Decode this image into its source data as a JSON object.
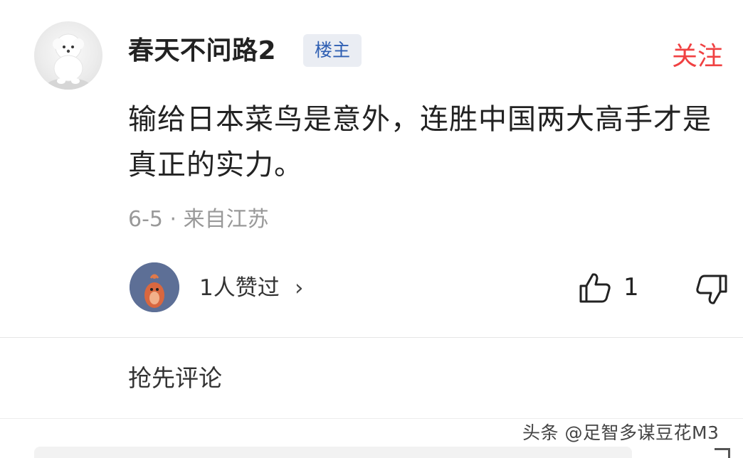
{
  "comment": {
    "user": {
      "name": "春天不问路2",
      "badge": "楼主",
      "avatar_icon": "white-dog-avatar-icon"
    },
    "follow_label": "关注",
    "text": "输给日本菜鸟是意外，连胜中国两大高手才是真正的实力。",
    "date": "6-5",
    "separator": "·",
    "location": "来自江苏",
    "likers": {
      "avatar_icon": "cartoon-avatar-icon",
      "text": "1人赞过",
      "chevron": "›"
    },
    "like_count": "1",
    "like_icon": "thumb-up-icon",
    "dislike_icon": "thumb-down-icon"
  },
  "first_comment_label": "抢先评论",
  "watermark": "头条 @足智多谋豆花M3",
  "colors": {
    "accent_red": "#f04142",
    "badge_blue": "#2f5fb3",
    "badge_bg": "#eaedf3",
    "meta_gray": "#999999"
  }
}
